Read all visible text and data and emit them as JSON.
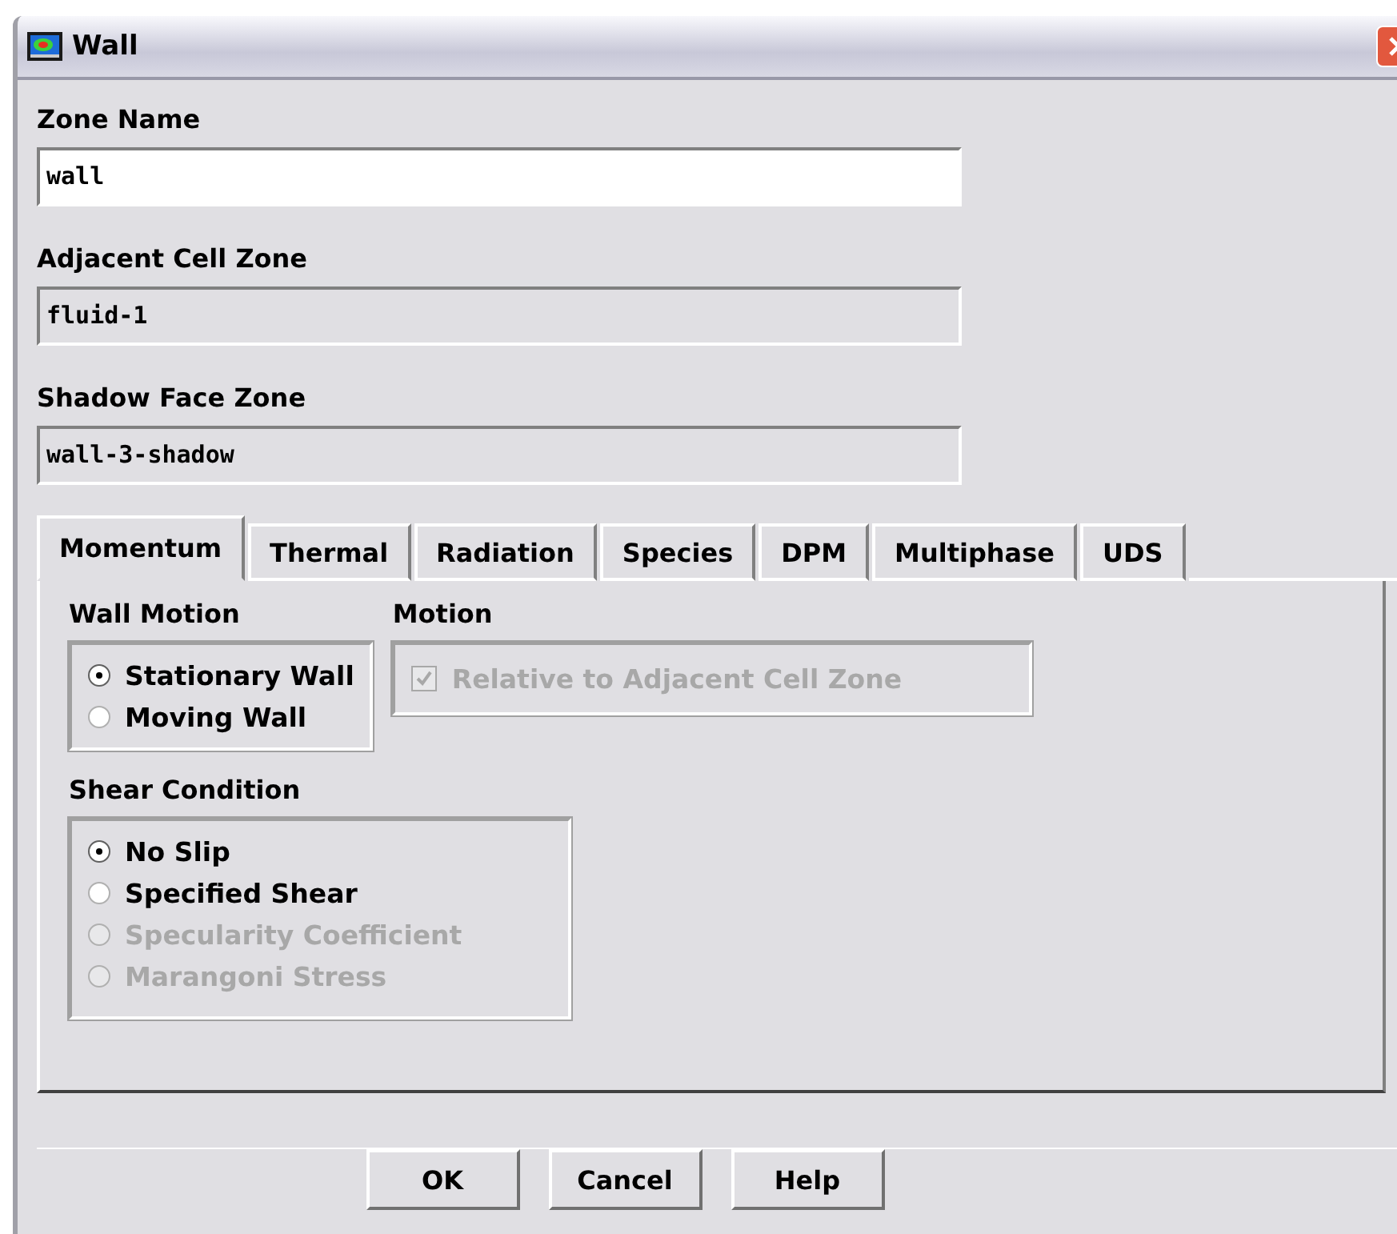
{
  "window": {
    "title": "Wall"
  },
  "fields": [
    {
      "label": "Zone Name",
      "value": "wall",
      "disabled": false
    },
    {
      "label": "Adjacent Cell Zone",
      "value": "fluid-1",
      "disabled": true
    },
    {
      "label": "Shadow Face Zone",
      "value": "wall-3-shadow",
      "disabled": true
    }
  ],
  "tabs": [
    {
      "label": "Momentum",
      "selected": true
    },
    {
      "label": "Thermal",
      "selected": false
    },
    {
      "label": "Radiation",
      "selected": false
    },
    {
      "label": "Species",
      "selected": false
    },
    {
      "label": "DPM",
      "selected": false
    },
    {
      "label": "Multiphase",
      "selected": false
    },
    {
      "label": "UDS",
      "selected": false
    }
  ],
  "wall_motion": {
    "title": "Wall Motion",
    "options": [
      {
        "label": "Stationary Wall",
        "selected": true,
        "disabled": false
      },
      {
        "label": "Moving Wall",
        "selected": false,
        "disabled": false
      }
    ]
  },
  "motion": {
    "title": "Motion",
    "checkbox": {
      "label": "Relative to Adjacent Cell Zone",
      "checked": true,
      "disabled": true
    }
  },
  "shear_condition": {
    "title": "Shear Condition",
    "options": [
      {
        "label": "No Slip",
        "selected": true,
        "disabled": false
      },
      {
        "label": "Specified Shear",
        "selected": false,
        "disabled": false
      },
      {
        "label": "Specularity Coefficient",
        "selected": false,
        "disabled": true
      },
      {
        "label": "Marangoni Stress",
        "selected": false,
        "disabled": true
      }
    ]
  },
  "buttons": [
    "OK",
    "Cancel",
    "Help"
  ]
}
